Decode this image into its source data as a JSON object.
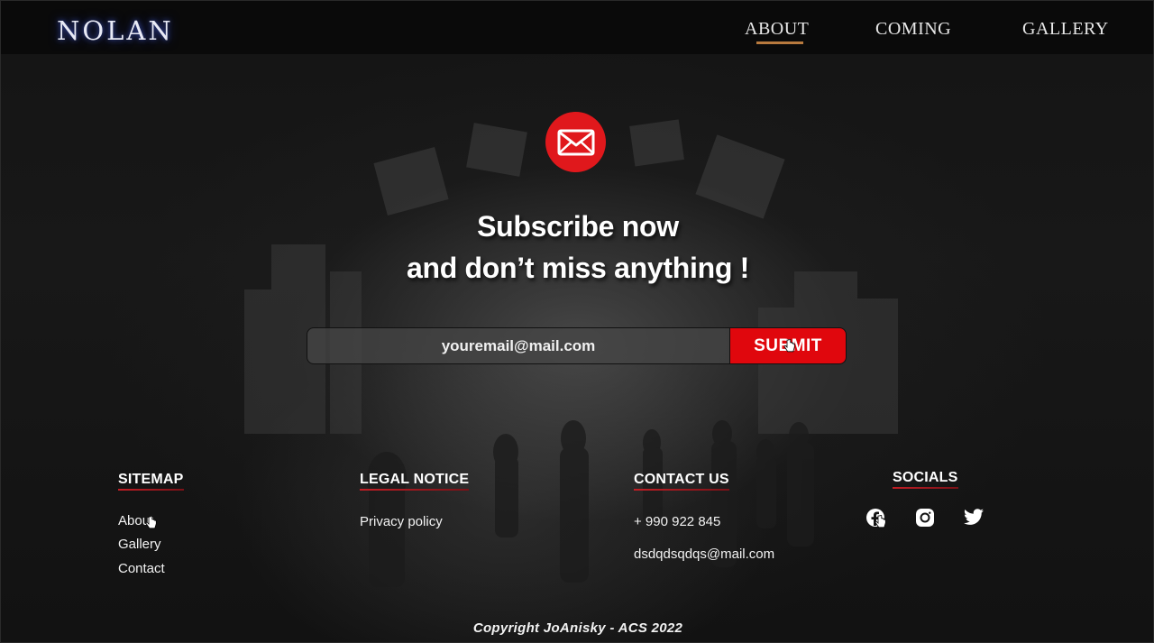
{
  "header": {
    "logo": "NOLAN",
    "nav": [
      {
        "label": "ABOUT",
        "active": true
      },
      {
        "label": "COMING",
        "active": false
      },
      {
        "label": "GALLERY",
        "active": false
      }
    ]
  },
  "subscribe": {
    "icon": "envelope-icon",
    "headline_line1": "Subscribe now",
    "headline_line2": "and don’t miss anything !",
    "email_placeholder": "youremail@mail.com",
    "submit_label": "SUBMIT"
  },
  "footer": {
    "sitemap": {
      "title": "SITEMAP",
      "links": [
        "About",
        "Gallery",
        "Contact"
      ]
    },
    "legal": {
      "title": "LEGAL NOTICE",
      "links": [
        "Privacy policy"
      ]
    },
    "contact": {
      "title": "CONTACT US",
      "phone": "+ 990 922 845",
      "email": "dsdqdsqdqs@mail.com"
    },
    "socials": {
      "title": "SOCIALS",
      "icons": [
        "facebook-icon",
        "instagram-icon",
        "twitter-icon"
      ]
    },
    "copyright": "Copyright JoAnisky - ACS 2022"
  },
  "colors": {
    "accent_red": "#e0070d",
    "nav_underline": "#b87a3e",
    "background": "#141414"
  }
}
